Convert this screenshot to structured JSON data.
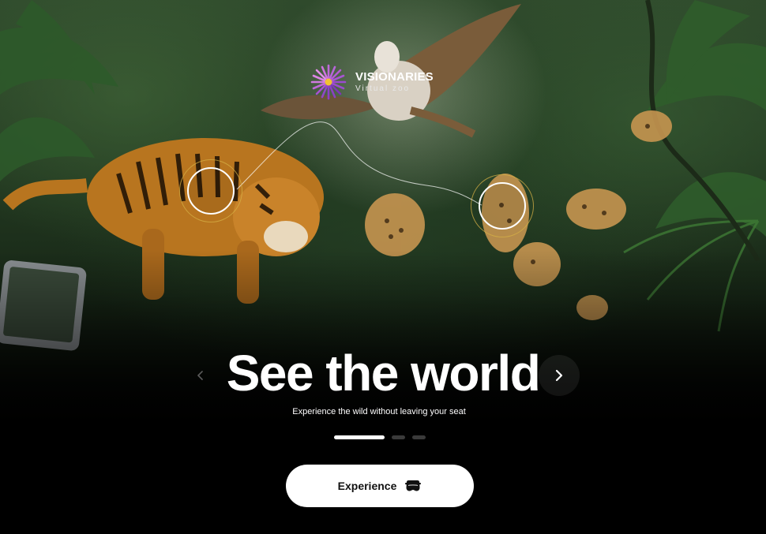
{
  "brand": {
    "name": "VISIONARIES",
    "tagline": "Virtual zoo",
    "logo_icon": "purple-flower-burst-logo-icon"
  },
  "hero": {
    "title": "See the world",
    "subtitle": "Experience the wild without leaving your seat"
  },
  "carousel": {
    "prev_icon": "chevron-left-icon",
    "next_icon": "chevron-right-icon",
    "slide_count": 3,
    "active_slide": 1
  },
  "cta": {
    "label": "Experience",
    "icon": "vr-headset-icon"
  },
  "hotspots": [
    {
      "target": "tiger"
    },
    {
      "target": "serval"
    }
  ],
  "colors": {
    "accent_ring": "#d6b046",
    "cta_background": "#ffffff",
    "text_primary": "#ffffff"
  }
}
